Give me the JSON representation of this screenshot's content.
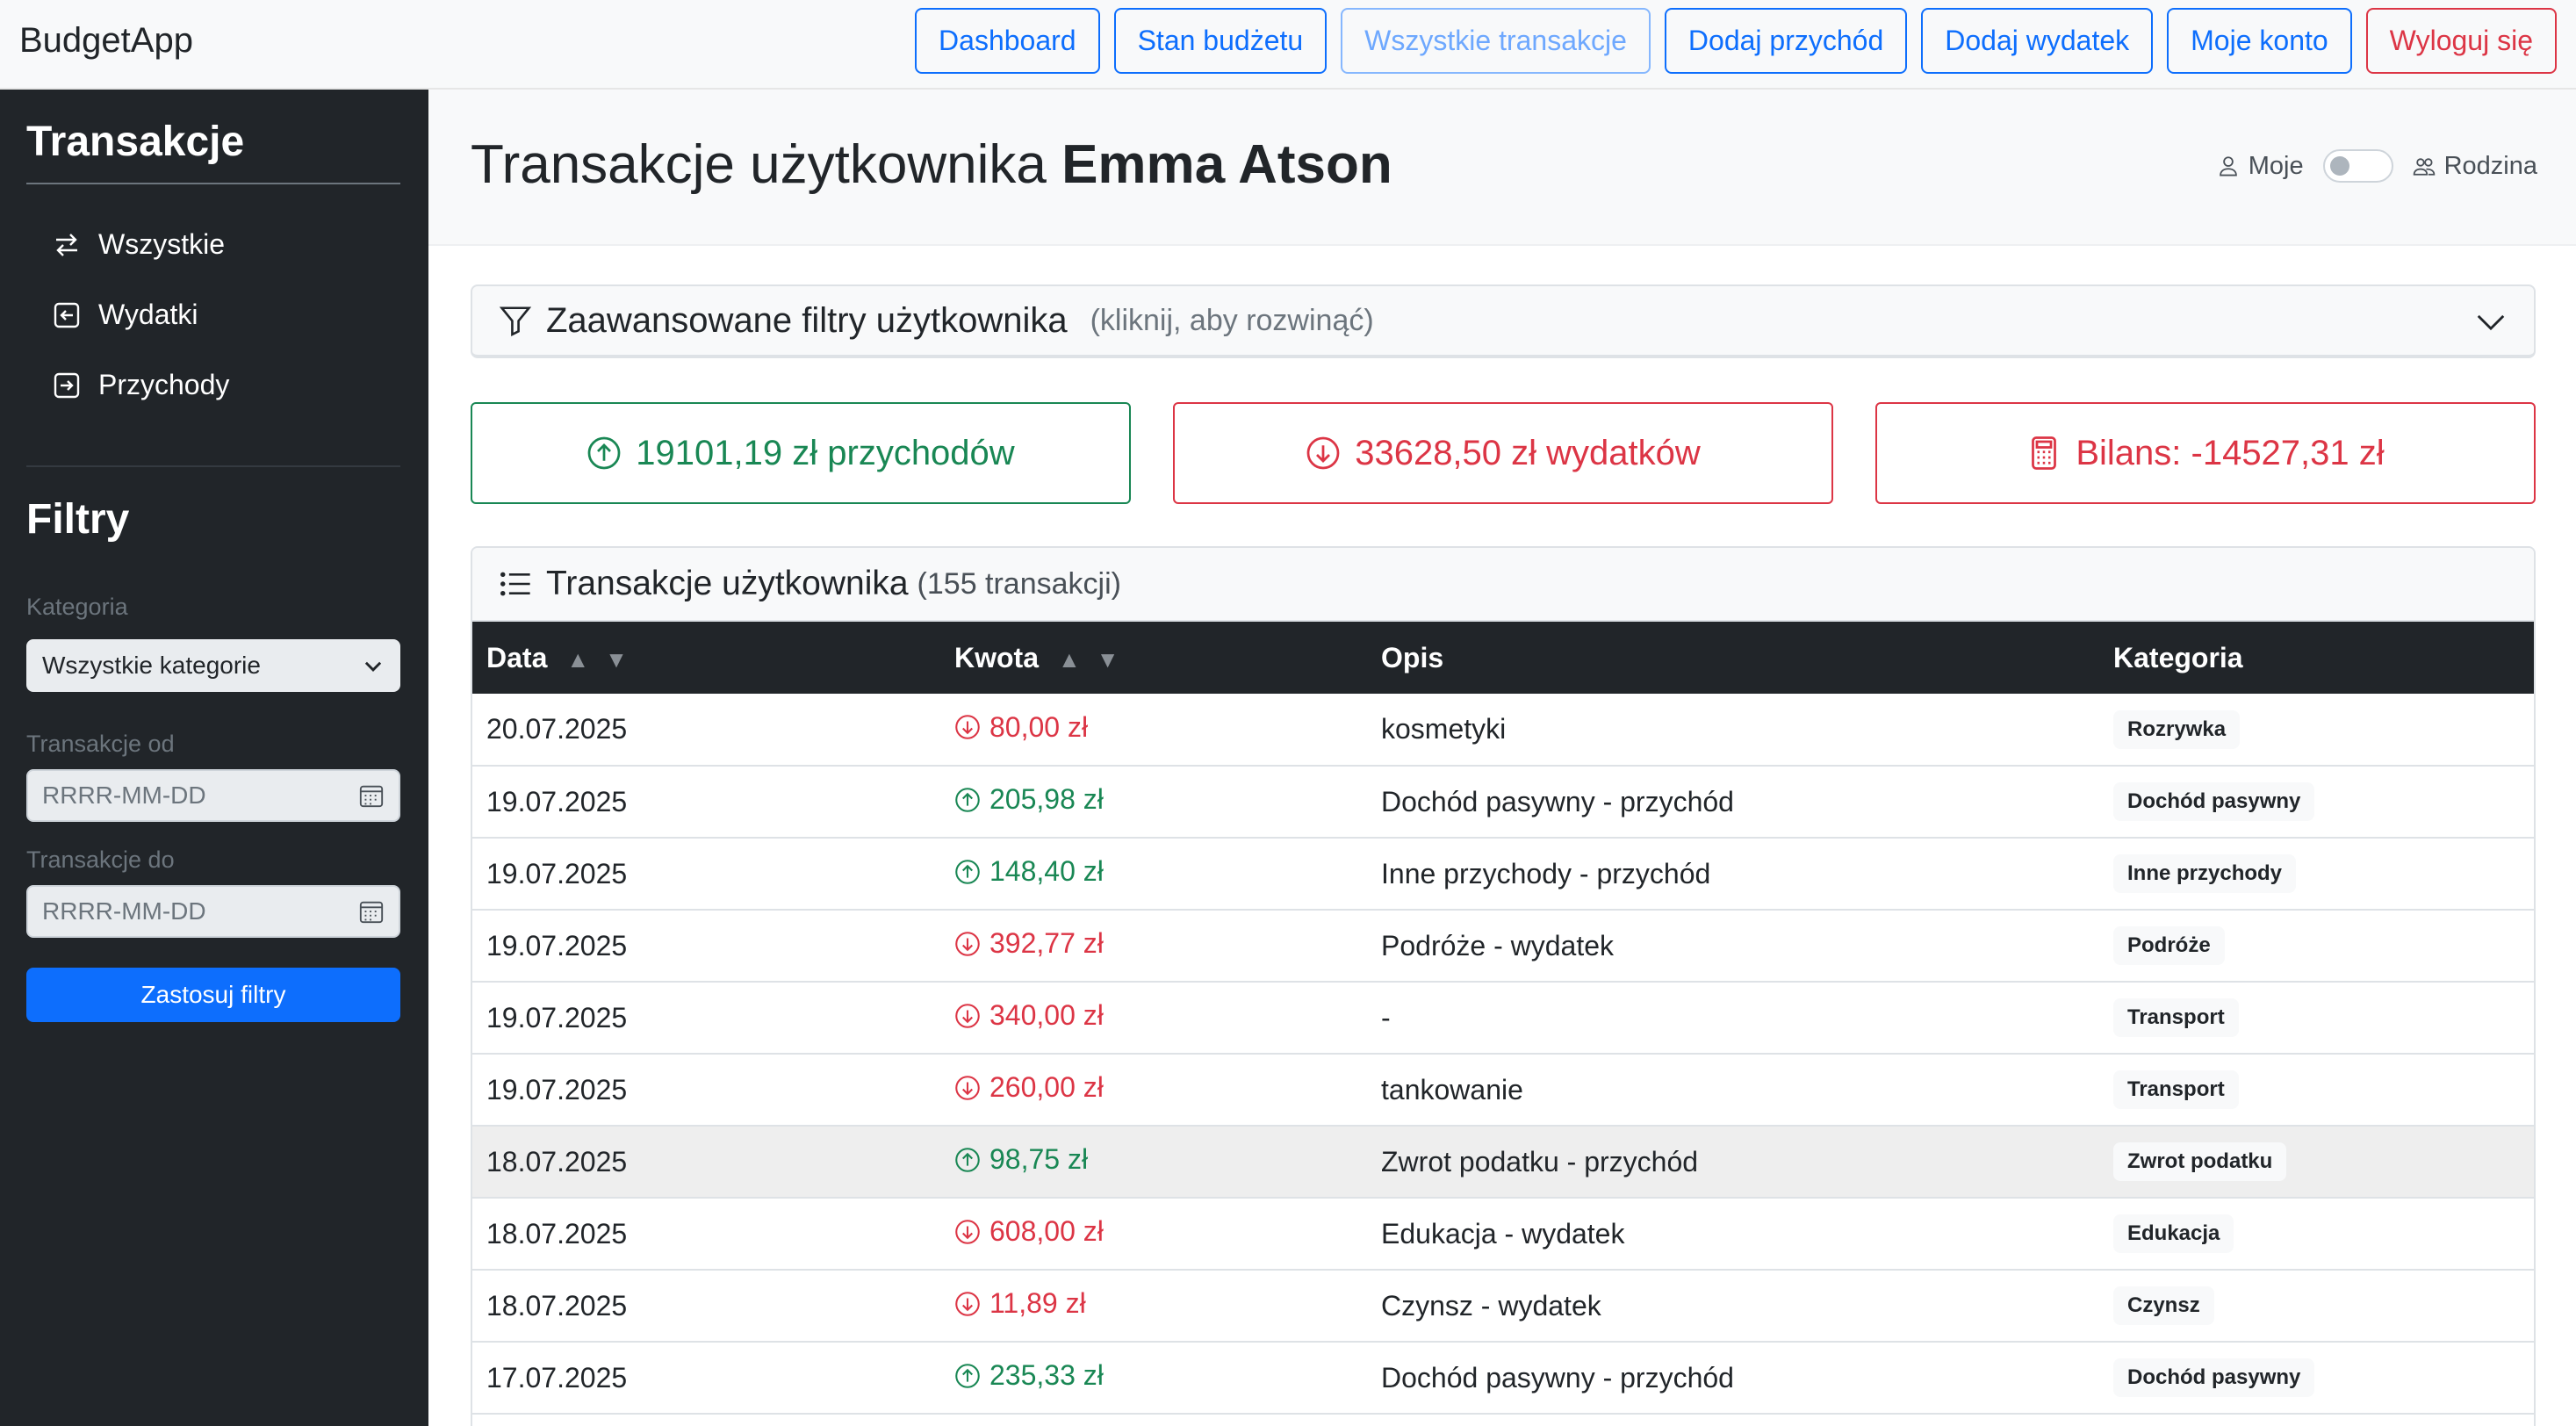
{
  "brand": "BudgetApp",
  "nav": [
    {
      "label": "Dashboard",
      "style": "primary"
    },
    {
      "label": "Stan budżetu",
      "style": "primary"
    },
    {
      "label": "Wszystkie transakcje",
      "style": "muted"
    },
    {
      "label": "Dodaj przychód",
      "style": "primary"
    },
    {
      "label": "Dodaj wydatek",
      "style": "primary"
    },
    {
      "label": "Moje konto",
      "style": "primary"
    },
    {
      "label": "Wyloguj się",
      "style": "danger"
    }
  ],
  "sidebar": {
    "title": "Transakcje",
    "items": [
      {
        "label": "Wszystkie",
        "icon": "arrows-left-right-icon"
      },
      {
        "label": "Wydatki",
        "icon": "box-arrow-left-icon"
      },
      {
        "label": "Przychody",
        "icon": "box-arrow-right-icon"
      }
    ],
    "filters_title": "Filtry",
    "category_label": "Kategoria",
    "category_value": "Wszystkie kategorie",
    "from_label": "Transakcje od",
    "from_placeholder": "RRRR-MM-DD",
    "to_label": "Transakcje do",
    "to_placeholder": "RRRR-MM-DD",
    "apply_label": "Zastosuj filtry"
  },
  "main": {
    "title_prefix": "Transakcje użytkownika",
    "title_user": "Emma Atson",
    "toggle_left": "Moje",
    "toggle_right": "Rodzina",
    "filters_title": "Zaawansowane filtry użytkownika",
    "filters_hint": "(kliknij, aby rozwinąć)",
    "stats": {
      "income": "19101,19 zł przychodów",
      "expenses": "33628,50 zł wydatków",
      "balance": "Bilans: -14527,31 zł"
    },
    "list_title": "Transakcje użytkownika",
    "list_count": "(155 transakcji)"
  },
  "colors": {
    "primary": "#0d6efd",
    "success": "#198754",
    "danger": "#dc3545",
    "dark": "#212529"
  },
  "table": {
    "columns": [
      "Data",
      "Kwota",
      "Opis",
      "Kategoria"
    ],
    "rows": [
      {
        "date": "20.07.2025",
        "amount": "80,00 zł",
        "type": "out",
        "desc": "kosmetyki",
        "category": "Rozrywka"
      },
      {
        "date": "19.07.2025",
        "amount": "205,98 zł",
        "type": "in",
        "desc": "Dochód pasywny - przychód",
        "category": "Dochód pasywny"
      },
      {
        "date": "19.07.2025",
        "amount": "148,40 zł",
        "type": "in",
        "desc": "Inne przychody - przychód",
        "category": "Inne przychody"
      },
      {
        "date": "19.07.2025",
        "amount": "392,77 zł",
        "type": "out",
        "desc": "Podróże - wydatek",
        "category": "Podróże"
      },
      {
        "date": "19.07.2025",
        "amount": "340,00 zł",
        "type": "out",
        "desc": "-",
        "category": "Transport"
      },
      {
        "date": "19.07.2025",
        "amount": "260,00 zł",
        "type": "out",
        "desc": "tankowanie",
        "category": "Transport"
      },
      {
        "date": "18.07.2025",
        "amount": "98,75 zł",
        "type": "in",
        "desc": "Zwrot podatku - przychód",
        "category": "Zwrot podatku",
        "highlighted": true
      },
      {
        "date": "18.07.2025",
        "amount": "608,00 zł",
        "type": "out",
        "desc": "Edukacja - wydatek",
        "category": "Edukacja"
      },
      {
        "date": "18.07.2025",
        "amount": "11,89 zł",
        "type": "out",
        "desc": "Czynsz - wydatek",
        "category": "Czynsz"
      },
      {
        "date": "17.07.2025",
        "amount": "235,33 zł",
        "type": "in",
        "desc": "Dochód pasywny - przychód",
        "category": "Dochód pasywny"
      }
    ]
  }
}
